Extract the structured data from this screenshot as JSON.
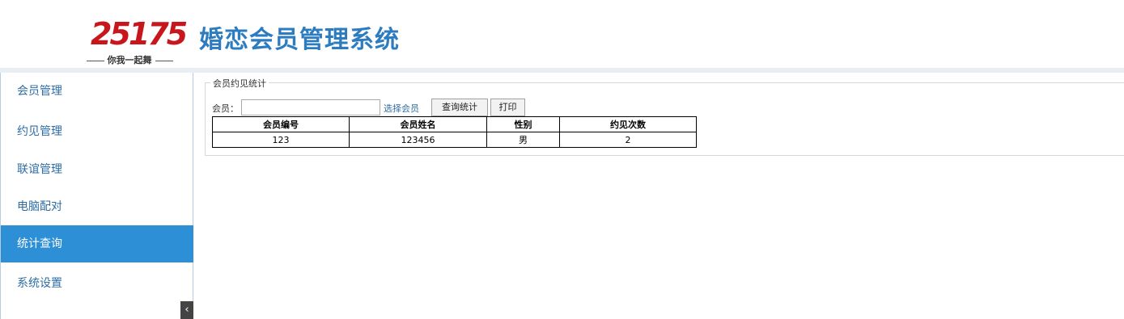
{
  "header": {
    "logo_number": "25175",
    "logo_tagline": "你我一起舞",
    "app_title": "婚恋会员管理系统"
  },
  "sidebar": {
    "items": [
      {
        "label": "会员管理"
      },
      {
        "label": "约见管理"
      },
      {
        "label": "联谊管理"
      },
      {
        "label": "电脑配对"
      },
      {
        "label": "统计查询",
        "active": true
      },
      {
        "label": "系统设置"
      }
    ],
    "collapse_glyph": "‹"
  },
  "panel": {
    "legend": "会员约见统计",
    "member_label": "会员：",
    "member_input_value": "",
    "select_member_link": "选择会员",
    "query_button": "查询统计",
    "print_button": "打印"
  },
  "table": {
    "headers": [
      "会员编号",
      "会员姓名",
      "性别",
      "约见次数"
    ],
    "rows": [
      [
        "123",
        "123456",
        "男",
        "2"
      ]
    ]
  },
  "colors": {
    "brand_blue": "#2e7cc0",
    "active_nav": "#2d8fd5",
    "logo_red": "#c8161d"
  }
}
